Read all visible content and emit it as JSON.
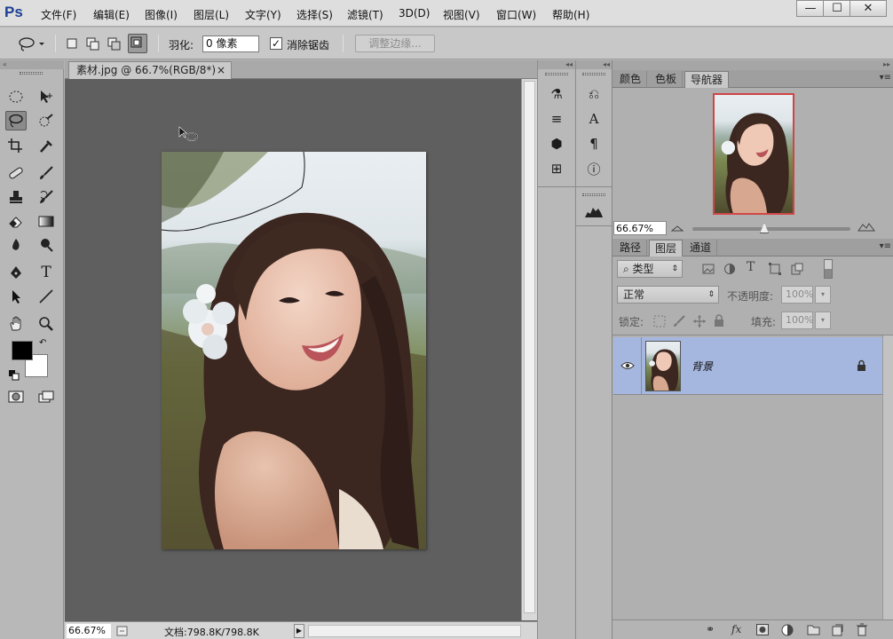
{
  "app": {
    "logo": "Ps"
  },
  "menu": [
    "文件(F)",
    "编辑(E)",
    "图像(I)",
    "图层(L)",
    "文字(Y)",
    "选择(S)",
    "滤镜(T)",
    "3D(D)",
    "视图(V)",
    "窗口(W)",
    "帮助(H)"
  ],
  "window_controls": {
    "minimize": "—",
    "maximize": "☐",
    "close": "✕"
  },
  "options": {
    "feather_label": "羽化:",
    "feather_value": "0 像素",
    "antialias_label": "消除锯齿",
    "antialias_checked": "✓",
    "refine_edge": "调整边缘..."
  },
  "document": {
    "tab_title": "素材.jpg @ 66.7%(RGB/8*)",
    "tab_close": "×",
    "zoom": "66.67%",
    "doc_info": "文档:798.8K/798.8K"
  },
  "panels": {
    "top_tabs": [
      "颜色",
      "色板",
      "导航器"
    ],
    "navigator_zoom": "66.67%",
    "layer_tabs": [
      "路径",
      "图层",
      "通道"
    ],
    "filter_kind": "类型",
    "blend_mode": "正常",
    "opacity_label": "不透明度:",
    "opacity_value": "100%",
    "lock_label": "锁定:",
    "fill_label": "填充:",
    "fill_value": "100%",
    "layer_name": "背景"
  },
  "colors": {
    "foreground": "#000000",
    "background": "#ffffff",
    "selected_layer": "#a6b7df",
    "nav_frame": "#d04646"
  }
}
